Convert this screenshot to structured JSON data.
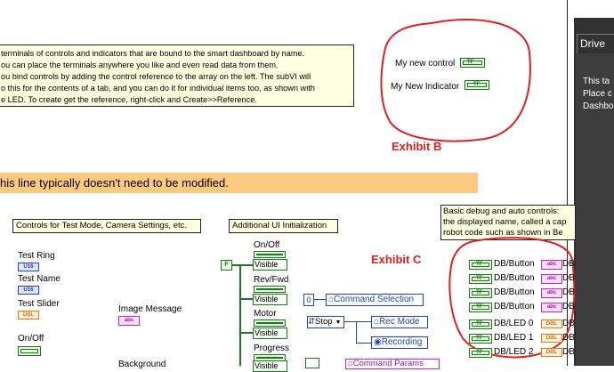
{
  "note_top": {
    "lines": [
      "terminals of controls and indicators that are bound to the smart dashboard by name.",
      "ou can place the terminals anywhere you like and even read data from them.",
      "ou bind controls by adding the control reference to the array on the left. The subVI will",
      "o this for the contents of a tab, and you can do it for individual items too, as shown with",
      "e LED. To create get the reference, right-click and Create>>Reference."
    ]
  },
  "exhibit_b": {
    "label": "Exhibit B",
    "control_label": "My new control",
    "indicator_label": "My New Indicator",
    "tf": "TF"
  },
  "banner": {
    "text": "his line typically doesn't need to be modified."
  },
  "panel": {
    "tab": "Drive",
    "lines": [
      "This ta",
      "Place c",
      "Dashbo"
    ]
  },
  "test_mode_note": {
    "text": "Controls for Test Mode, Camera Settings, etc."
  },
  "ui_init_note": {
    "text": "Additional UI Initialization"
  },
  "debug_note": {
    "lines": [
      "Basic debug and auto controls:",
      "the displayed name, called a cap",
      "robot code such as shown in Be"
    ]
  },
  "exhibit_c": {
    "label": "Exhibit C"
  },
  "left_controls": {
    "test_ring": "Test Ring",
    "test_name": "Test Name",
    "test_slider": "Test Slider",
    "on_off": "On/Off",
    "u16": "U16",
    "dbl": "DBL",
    "image_message": "Image Message",
    "abc": "abc",
    "background": "Background"
  },
  "ui_init": {
    "false_const": "F",
    "items": [
      {
        "label": "On/Off",
        "prop": "Visible"
      },
      {
        "label": "Rev/Fwd",
        "prop": "Visible"
      },
      {
        "label": "Motor",
        "prop": "Visible"
      },
      {
        "label": "Progress",
        "prop": "Visible"
      }
    ],
    "zero_const": "0",
    "command_selection": "Command Selection",
    "stop_enum": "Stop",
    "rec_mode": "Rec Mode",
    "recording": "Recording",
    "command_params": "Command Params"
  },
  "db_controls": {
    "buttons": [
      "DB/Button",
      "DB/Button",
      "DB/Button",
      "DB/Button"
    ],
    "leds": [
      "DB/LED 0",
      "DB/LED 1",
      "DB/LED 2"
    ],
    "right_prefix": "DB"
  },
  "colors": {
    "annotation_red": "#e02020",
    "banner": "#fbc97f",
    "note_bg": "#ffffe1",
    "bool_green": "#1a7a1a",
    "int_blue": "#2244bb",
    "string_pink": "#cc22cc",
    "dbl_orange": "#e07a10"
  }
}
